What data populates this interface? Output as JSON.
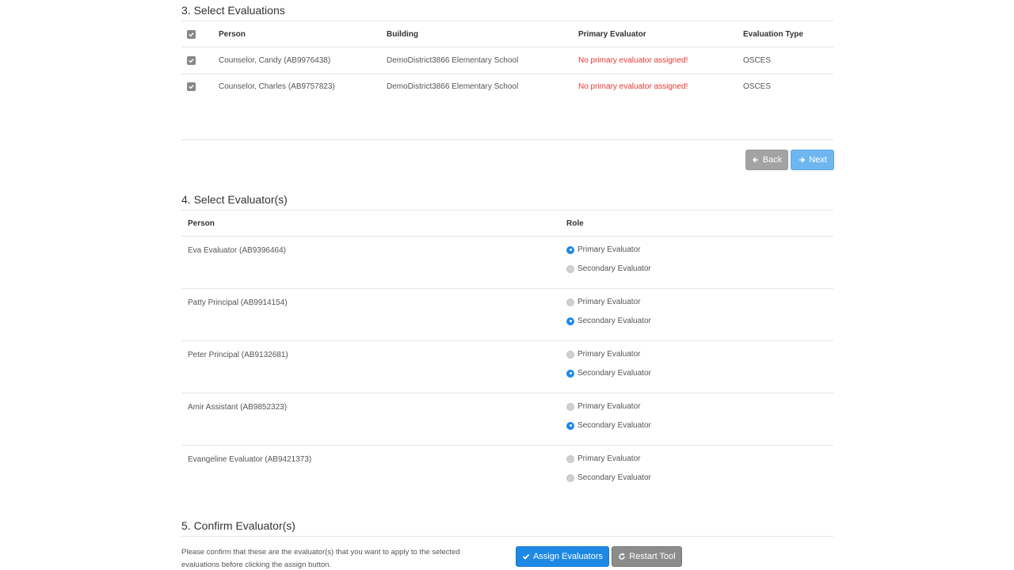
{
  "section3": {
    "title": "3. Select Evaluations",
    "headers": {
      "person": "Person",
      "building": "Building",
      "primary": "Primary Evaluator",
      "type": "Evaluation Type"
    },
    "rows": [
      {
        "person": "Counselor, Candy (AB9976438)",
        "building": "DemoDistrict3866 Elementary School",
        "primary": "No primary evaluator assigned!",
        "type": "OSCES",
        "checked": true
      },
      {
        "person": "Counselor, Charles (AB9757823)",
        "building": "DemoDistrict3866 Elementary School",
        "primary": "No primary evaluator assigned!",
        "type": "OSCES",
        "checked": true
      }
    ],
    "back_label": "Back",
    "next_label": "Next"
  },
  "section4": {
    "title": "4. Select Evaluator(s)",
    "headers": {
      "person": "Person",
      "role": "Role"
    },
    "role_options": {
      "primary": "Primary Evaluator",
      "secondary": "Secondary Evaluator"
    },
    "evaluators": [
      {
        "name": "Eva Evaluator (AB9396464)",
        "selected": "primary"
      },
      {
        "name": "Patty Principal (AB9914154)",
        "selected": "secondary"
      },
      {
        "name": "Peter Principal (AB9132681)",
        "selected": "secondary"
      },
      {
        "name": "Amir Assistant (AB9852323)",
        "selected": "secondary"
      },
      {
        "name": "Evangeline Evaluator (AB9421373)",
        "selected": "none"
      }
    ]
  },
  "section5": {
    "title": "5. Confirm Evaluator(s)",
    "description": "Please confirm that these are the evaluator(s) that you want to apply to the selected evaluations before clicking the assign button.",
    "assign_label": "Assign Evaluators",
    "restart_label": "Restart Tool"
  },
  "colors": {
    "accent": "#1e88e5",
    "warning": "#e53935",
    "next": "#6fb6f0",
    "muted_button": "#a3a3a3"
  }
}
